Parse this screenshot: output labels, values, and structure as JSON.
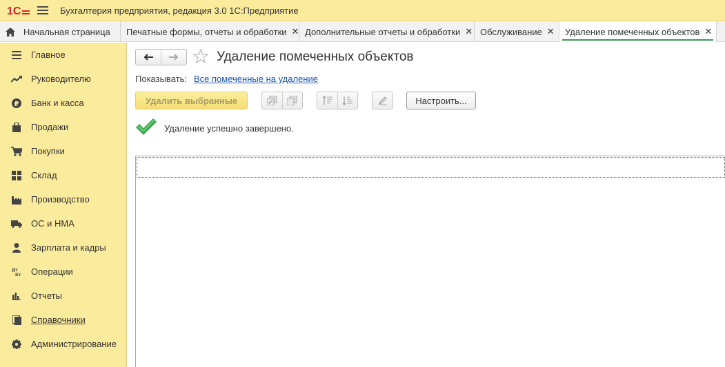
{
  "app": {
    "title": "Бухгалтерия предприятия, редакция 3.0 1С:Предприятие",
    "logo_text": "1С"
  },
  "tabs": [
    {
      "label": "Начальная страница",
      "closable": false,
      "active": false
    },
    {
      "label": "Печатные формы, отчеты и обработки",
      "closable": true,
      "active": false
    },
    {
      "label": "Дополнительные отчеты и обработки",
      "closable": true,
      "active": false
    },
    {
      "label": "Обслуживание",
      "closable": true,
      "active": false
    },
    {
      "label": "Удаление помеченных объектов",
      "closable": true,
      "active": true
    }
  ],
  "close_glyph": "✕",
  "sidebar": {
    "items": [
      {
        "label": "Главное",
        "icon": "list-icon"
      },
      {
        "label": "Руководителю",
        "icon": "trend-icon"
      },
      {
        "label": "Банк и касса",
        "icon": "ruble-icon"
      },
      {
        "label": "Продажи",
        "icon": "bag-icon"
      },
      {
        "label": "Покупки",
        "icon": "cart-icon"
      },
      {
        "label": "Склад",
        "icon": "warehouse-icon"
      },
      {
        "label": "Производство",
        "icon": "factory-icon"
      },
      {
        "label": "ОС и НМА",
        "icon": "truck-icon"
      },
      {
        "label": "Зарплата и кадры",
        "icon": "person-icon"
      },
      {
        "label": "Операции",
        "icon": "dt-kt-icon"
      },
      {
        "label": "Отчеты",
        "icon": "bar-chart-icon"
      },
      {
        "label": "Справочники",
        "icon": "books-icon"
      },
      {
        "label": "Администрирование",
        "icon": "gear-icon"
      }
    ]
  },
  "main": {
    "title": "Удаление помеченных объектов",
    "show_label": "Показывать:",
    "show_link": "Все помеченные на удаление",
    "delete_button": "Удалить выбранные",
    "settings_button": "Настроить...",
    "status_text": "Удаление успешно завершено."
  },
  "colors": {
    "accent_yellow": "#fbeb9c",
    "link_blue": "#1a58b6",
    "success_green": "#3aa84a",
    "logo_red": "#d8232a"
  }
}
